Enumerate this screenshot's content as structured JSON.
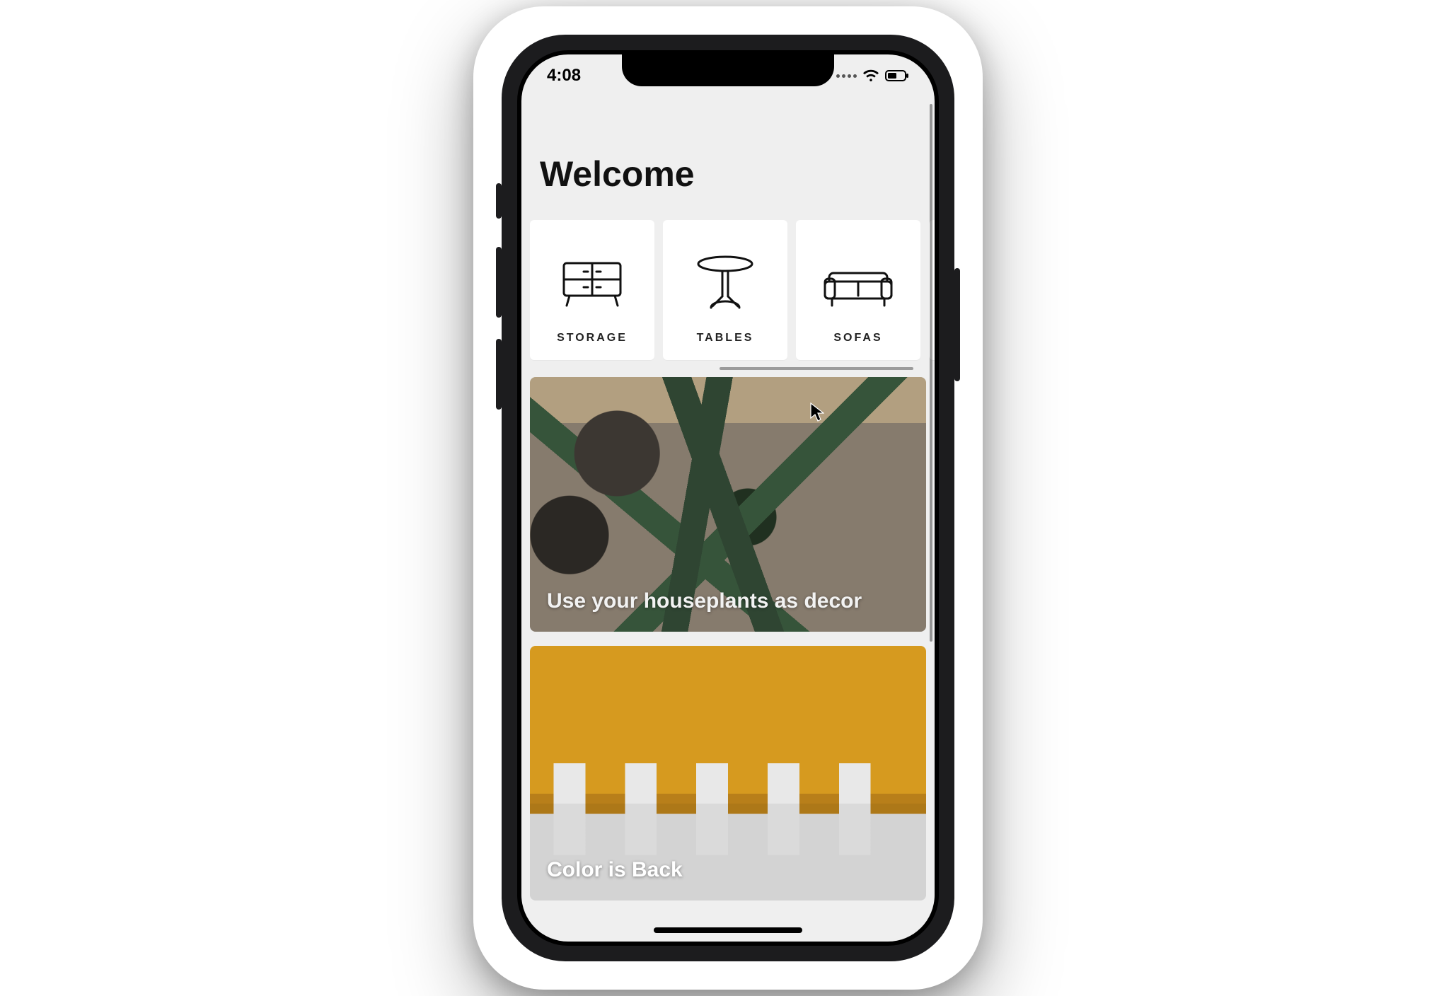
{
  "status": {
    "time": "4:08"
  },
  "header": {
    "title": "Welcome"
  },
  "categories": [
    {
      "label": "STORAGE",
      "icon": "storage"
    },
    {
      "label": "TABLES",
      "icon": "table"
    },
    {
      "label": "SOFAS",
      "icon": "sofa"
    }
  ],
  "articles": [
    {
      "title": "Use your houseplants as decor",
      "style": "plants"
    },
    {
      "title": "Color is Back",
      "style": "color"
    }
  ]
}
